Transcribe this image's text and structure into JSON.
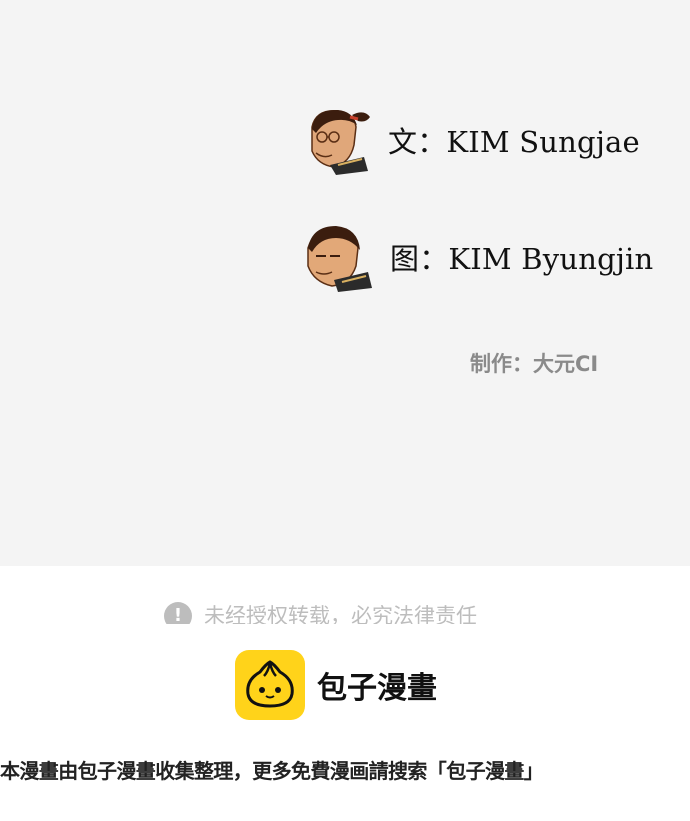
{
  "credits": {
    "writer": "文：KIM Sungjae",
    "artist": "图：KIM Byungjin",
    "producer": "制作：大元CI"
  },
  "notice": {
    "icon": "!",
    "text": "未经授权转载，必究法律责任"
  },
  "brand": {
    "name": "包子漫畫",
    "icon_name": "bun-logo-icon",
    "icon_color": "#ffd31a"
  },
  "footer": {
    "text": "本漫畫由包子漫畫收集整理，更多免費漫画請搜索「包子漫畫」"
  }
}
